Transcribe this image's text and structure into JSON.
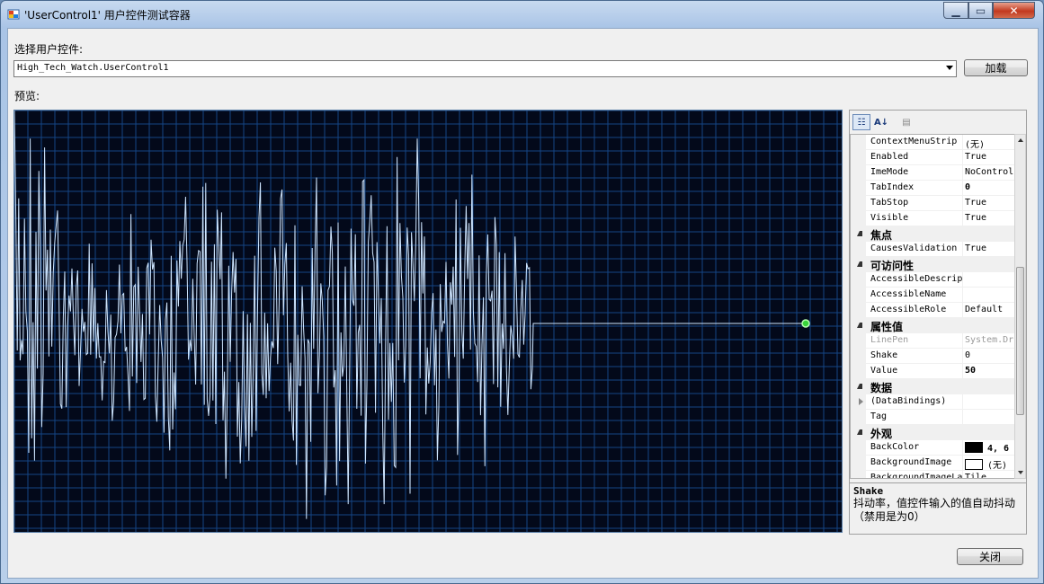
{
  "window": {
    "title": "'UserControl1' 用户控件测试容器",
    "minimize_glyph": "▁",
    "maximize_glyph": "▭",
    "close_glyph": "✕"
  },
  "form": {
    "select_label": "选择用户控件:",
    "selected_control": "High_Tech_Watch.UserControl1",
    "load_button": "加载",
    "preview_label": "预览:",
    "close_button": "关闭"
  },
  "colors": {
    "preview_background": "#03091a",
    "grid": "#1c5aa8",
    "signal": "#cfe6ff",
    "indicator": "#39d43a"
  },
  "icons": {
    "categorized": "categorized-icon",
    "alphabetical": "alphabetical-icon",
    "property_pages": "property-pages-icon"
  },
  "property_grid": {
    "rows": [
      {
        "type": "prop",
        "name": "ContextMenuStrip",
        "value": "(无)"
      },
      {
        "type": "prop",
        "name": "Enabled",
        "value": "True"
      },
      {
        "type": "prop",
        "name": "ImeMode",
        "value": "NoControl"
      },
      {
        "type": "prop",
        "name": "TabIndex",
        "value": "0",
        "bold": true
      },
      {
        "type": "prop",
        "name": "TabStop",
        "value": "True"
      },
      {
        "type": "prop",
        "name": "Visible",
        "value": "True"
      },
      {
        "type": "cat",
        "name": "焦点"
      },
      {
        "type": "prop",
        "name": "CausesValidation",
        "value": "True"
      },
      {
        "type": "cat",
        "name": "可访问性"
      },
      {
        "type": "prop",
        "name": "AccessibleDescription",
        "value": ""
      },
      {
        "type": "prop",
        "name": "AccessibleName",
        "value": ""
      },
      {
        "type": "prop",
        "name": "AccessibleRole",
        "value": "Default"
      },
      {
        "type": "cat",
        "name": "属性值"
      },
      {
        "type": "prop",
        "name": "LinePen",
        "value": "System.Drawing.Pen",
        "disabled": true
      },
      {
        "type": "prop",
        "name": "Shake",
        "value": "0"
      },
      {
        "type": "prop",
        "name": "Value",
        "value": "50",
        "bold": true
      },
      {
        "type": "cat",
        "name": "数据"
      },
      {
        "type": "prop",
        "name": "(DataBindings)",
        "value": "",
        "collapsed": true
      },
      {
        "type": "prop",
        "name": "Tag",
        "value": ""
      },
      {
        "type": "cat",
        "name": "外观"
      },
      {
        "type": "prop",
        "name": "BackColor",
        "value": "4, 6",
        "bold": true,
        "swatch": "#000000"
      },
      {
        "type": "prop",
        "name": "BackgroundImage",
        "value": "(无)",
        "swatch": "#ffffff"
      },
      {
        "type": "prop",
        "name": "BackgroundImageLayout",
        "value": "Tile"
      }
    ],
    "help_title": "Shake",
    "help_line1": "抖动率，值控件输入的值自动抖动",
    "help_line2": "（禁用是为0）"
  }
}
